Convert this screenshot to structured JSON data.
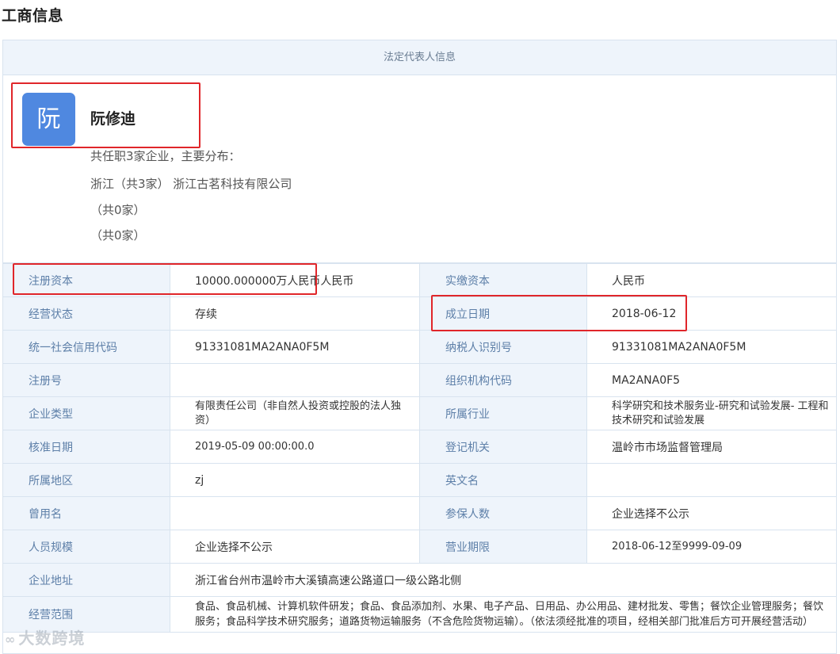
{
  "page_title": "工商信息",
  "legal_rep": {
    "header": "法定代表人信息",
    "avatar_char": "阮",
    "name": "阮修迪",
    "summary": "共任职3家企业，主要分布：",
    "line1": "浙江（共3家） 浙江古茗科技有限公司",
    "line2": "（共0家）",
    "line3": "（共0家）"
  },
  "rows": [
    {
      "k1": "注册资本",
      "v1": "10000.000000万人民币人民币",
      "k2": "实缴资本",
      "v2": "人民币"
    },
    {
      "k1": "经营状态",
      "v1": "存续",
      "k2": "成立日期",
      "v2": "2018-06-12"
    },
    {
      "k1": "统一社会信用代码",
      "v1": "91331081MA2ANA0F5M",
      "k2": "纳税人识别号",
      "v2": "91331081MA2ANA0F5M"
    },
    {
      "k1": "注册号",
      "v1": "",
      "k2": "组织机构代码",
      "v2": "MA2ANA0F5"
    },
    {
      "k1": "企业类型",
      "v1": "有限责任公司（非自然人投资或控股的法人独资）",
      "k2": "所属行业",
      "v2": "科学研究和技术服务业-研究和试验发展- 工程和技术研究和试验发展"
    },
    {
      "k1": "核准日期",
      "v1": "2019-05-09 00:00:00.0",
      "k2": "登记机关",
      "v2": "温岭市市场监督管理局"
    },
    {
      "k1": "所属地区",
      "v1": "zj",
      "k2": "英文名",
      "v2": ""
    },
    {
      "k1": "曾用名",
      "v1": "",
      "k2": "参保人数",
      "v2": "企业选择不公示"
    },
    {
      "k1": "人员规模",
      "v1": "企业选择不公示",
      "k2": "营业期限",
      "v2": "2018-06-12至9999-09-09"
    }
  ],
  "address": {
    "k": "企业地址",
    "v": "浙江省台州市温岭市大溪镇高速公路道口一级公路北侧"
  },
  "scope": {
    "k": "经营范围",
    "v": "食品、食品机械、计算机软件研发；食品、食品添加剂、水果、电子产品、日用品、办公用品、建材批发、零售；餐饮企业管理服务；餐饮服务；食品科学技术研究服务；道路货物运输服务（不含危险货物运输）。（依法须经批准的项目，经相关部门批准后方可开展经营活动）"
  },
  "watermark": "大数跨境",
  "colors": {
    "highlight_box": "#e0262a",
    "avatar_bg": "#4f88e0",
    "key_cell_bg": "#eef4fb",
    "key_text": "#5d7fa8"
  }
}
